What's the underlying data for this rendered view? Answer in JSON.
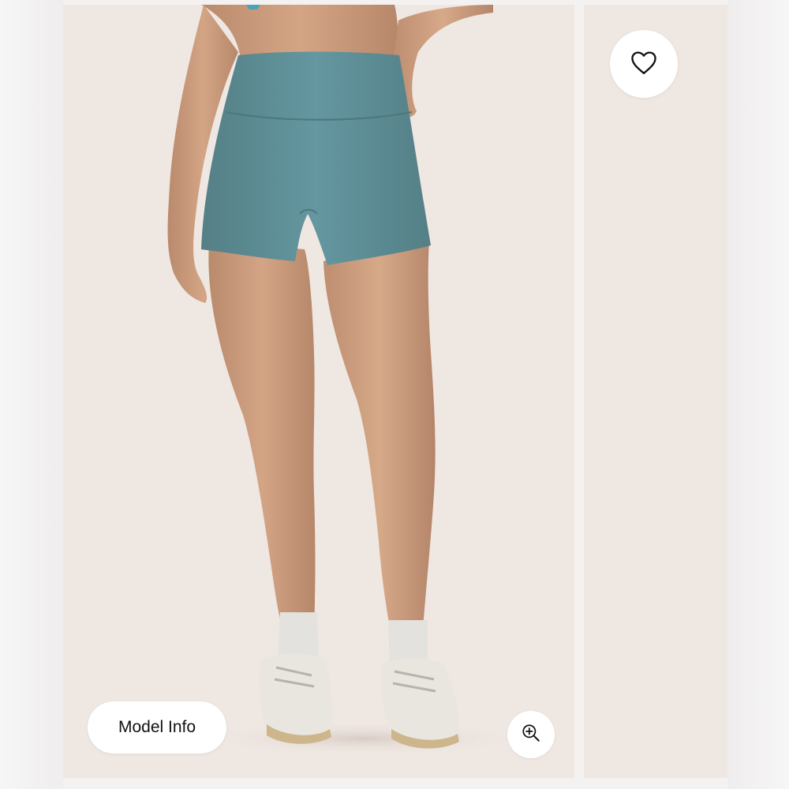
{
  "gallery": {
    "model_info_label": "Model Info",
    "wishlist_icon": "heart-outline-icon",
    "zoom_icon": "zoom-in-icon"
  },
  "colors": {
    "background": "#efe7e2",
    "shorts": "#5e8f94",
    "button_bg": "#ffffff",
    "text": "#111111"
  }
}
